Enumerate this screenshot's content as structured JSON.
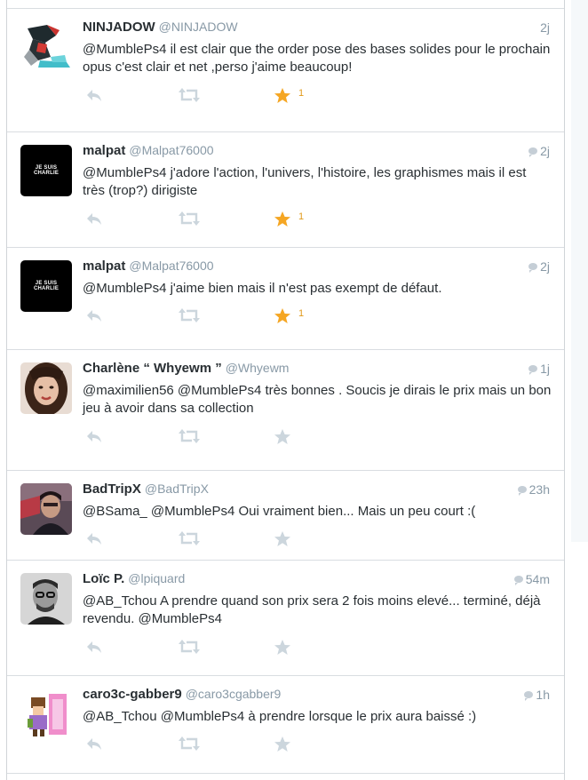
{
  "tweets": [
    {
      "name": "NINJADOW",
      "handle": "@NINJADOW",
      "time": "2j",
      "has_bubble": false,
      "text": "@MumblePs4 il est clair que the order pose des bases solides pour le prochain opus c'est clair et net ,perso j'aime beaucoup!",
      "favorited": true,
      "fav_count": "1",
      "avatar": "ninja-avatar"
    },
    {
      "name": "malpat",
      "handle": "@Malpat76000",
      "time": "2j",
      "has_bubble": true,
      "text": "@MumblePs4 j'adore l'action, l'univers, l'histoire, les graphismes mais il est très (trop?) dirigiste",
      "favorited": true,
      "fav_count": "1",
      "avatar": "je-suis-charlie-avatar",
      "avatar_text": [
        "JE SUIS",
        "CHARLIE"
      ]
    },
    {
      "name": "malpat",
      "handle": "@Malpat76000",
      "time": "2j",
      "has_bubble": true,
      "text": "@MumblePs4 j'aime bien mais il n'est pas exempt de défaut.",
      "favorited": true,
      "fav_count": "1",
      "avatar": "je-suis-charlie-avatar",
      "avatar_text": [
        "JE SUIS",
        "CHARLIE"
      ]
    },
    {
      "name": "Charlène “ Whyewm ”",
      "handle": "@Whyewm",
      "time": "1j",
      "has_bubble": true,
      "text": "@maximilien56 @MumblePs4 très bonnes . Soucis je dirais le prix mais un bon jeu à avoir dans sa collection",
      "favorited": false,
      "fav_count": "",
      "avatar": "woman-photo-avatar"
    },
    {
      "name": "BadTripX",
      "handle": "@BadTripX",
      "time": "23h",
      "has_bubble": true,
      "text": "@BSama_ @MumblePs4 Oui vraiment bien... Mais un peu court :(",
      "favorited": false,
      "fav_count": "",
      "avatar": "man-photo-avatar"
    },
    {
      "name": "Loïc P.",
      "handle": "@lpiquard",
      "time": "54m",
      "has_bubble": true,
      "text": "@AB_Tchou A prendre quand son prix sera 2  fois moins elevé...  terminé, déjà revendu. @MumblePs4",
      "favorited": false,
      "fav_count": "",
      "avatar": "bw-photo-avatar"
    },
    {
      "name": "caro3c-gabber9",
      "handle": "@caro3cgabber9",
      "time": "1h",
      "has_bubble": true,
      "text": "@AB_Tchou @MumblePs4 à prendre lorsque le prix aura baissé :)",
      "favorited": false,
      "fav_count": "",
      "avatar": "pixel-art-avatar"
    }
  ],
  "colors": {
    "star_active": "#f5a623",
    "icon_inactive": "#ccd6dd",
    "name": "#292f33",
    "meta": "#8899a6"
  }
}
